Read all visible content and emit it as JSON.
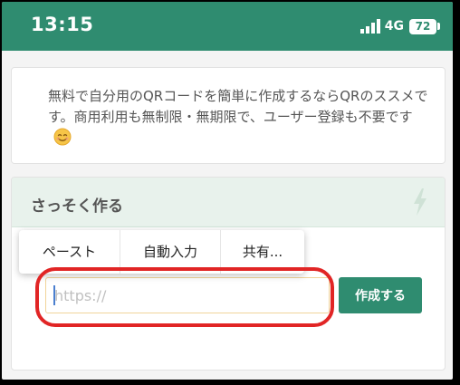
{
  "status_bar": {
    "time": "13:15",
    "network": "4G",
    "battery": "72",
    "background": "#2f8c70"
  },
  "intro_card": {
    "text": "無料で自分用のQRコードを簡単に作成するならQRのススメです。商用利用も無制限・無期限で、ユーザー登録も不要です",
    "emoji": "smile-icon"
  },
  "create_card": {
    "title": "さっそく作る",
    "icon": "bolt-icon",
    "input_placeholder": "https://",
    "input_value": "",
    "button_label": "作成する"
  },
  "context_menu": {
    "items": [
      "ペースト",
      "自動入力",
      "共有..."
    ]
  },
  "colors": {
    "accent": "#2f8c70",
    "header_bg": "#e8f2ec",
    "highlight": "#e12525",
    "input_border": "#f1d49a"
  }
}
